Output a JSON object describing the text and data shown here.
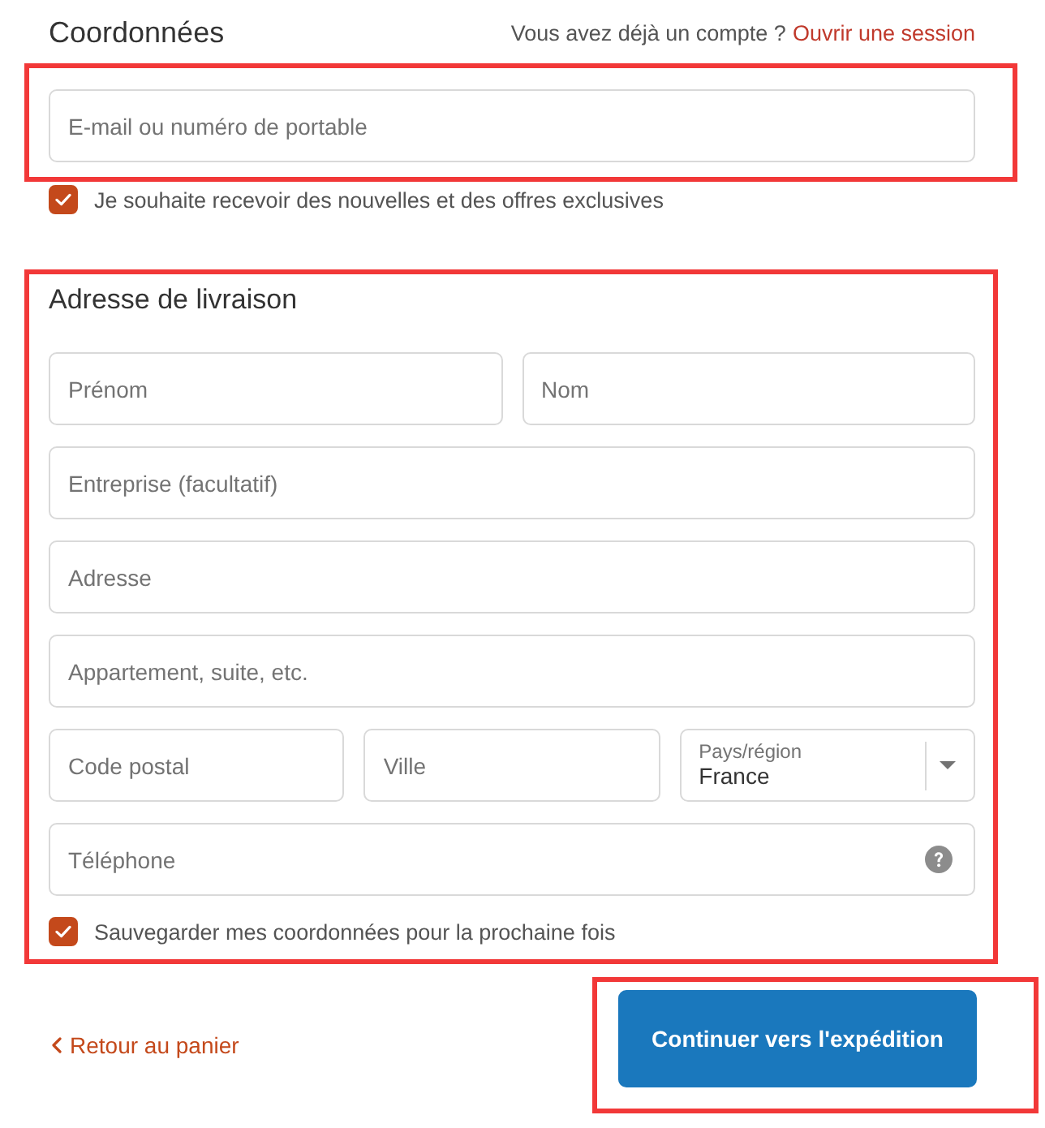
{
  "contact": {
    "title": "Coordonnées",
    "login_prompt": "Vous avez déjà un compte ?",
    "login_link": "Ouvrir une session",
    "highlighted": true,
    "email": {
      "placeholder": "E-mail ou numéro de portable"
    },
    "newsletter": {
      "label": "Je souhaite recevoir des nouvelles et des offres exclusives",
      "checked": true
    }
  },
  "shipping": {
    "title": "Adresse de livraison",
    "highlighted": true,
    "rows": [
      {
        "fields": [
          {
            "kind": "text",
            "placeholder": "Prénom"
          },
          {
            "kind": "text",
            "placeholder": "Nom"
          }
        ]
      },
      {
        "fields": [
          {
            "kind": "text",
            "placeholder": "Entreprise (facultatif)"
          }
        ]
      },
      {
        "fields": [
          {
            "kind": "text",
            "placeholder": "Adresse"
          }
        ]
      },
      {
        "fields": [
          {
            "kind": "text",
            "placeholder": "Appartement, suite, etc."
          }
        ]
      },
      {
        "fields": [
          {
            "kind": "text",
            "placeholder": "Code postal"
          },
          {
            "kind": "text",
            "placeholder": "Ville"
          },
          {
            "kind": "select",
            "label": "Pays/région",
            "value": "France"
          }
        ]
      },
      {
        "fields": [
          {
            "kind": "help",
            "placeholder": "Téléphone"
          }
        ]
      }
    ],
    "save": {
      "label": "Sauvegarder mes coordonnées pour la prochaine fois",
      "checked": true
    }
  },
  "footer": {
    "back_link": "Retour au panier",
    "continue_button": {
      "label": "Continuer vers l'expédition",
      "highlighted": true
    }
  }
}
